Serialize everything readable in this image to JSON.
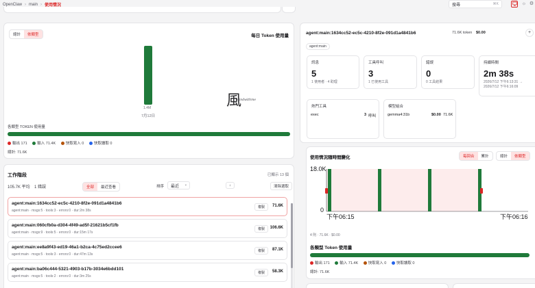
{
  "topbar": {
    "crumb1": "OpenClaw",
    "crumb2": "main",
    "crumb3": "使用情況",
    "sep": "›",
    "search_label": "搜尋",
    "search_kbd": "⌘K"
  },
  "icons": {
    "monitor": "monitor-icon",
    "sun": "sun-icon",
    "gear": "settings-icon",
    "accent": "#dc2626"
  },
  "daily": {
    "seg_total": "總計",
    "seg_bytype": "依類型",
    "title": "每日 Token 使用量",
    "bar_value_label": "1.4M",
    "bar_date": "7月12日",
    "watermark": "風",
    "watermark_sub": "windwithme",
    "type_title": "各類型 TOKEN 使用量",
    "legend": [
      {
        "label": "輸出 171",
        "color": "#dc2626"
      },
      {
        "label": "輸入 71.4K",
        "color": "#1f7a3a"
      },
      {
        "label": "快取寫入 0",
        "color": "#b45309"
      },
      {
        "label": "快取讀取 0",
        "color": "#2563eb"
      }
    ],
    "total": "總計: 71.6K"
  },
  "chart_data": [
    {
      "type": "bar",
      "title": "每日 Token 使用量",
      "categories": [
        "7月12日"
      ],
      "values": [
        1400000
      ],
      "data_labels": [
        "1.4M"
      ]
    },
    {
      "type": "bar",
      "title": "使用情況隨時間變化",
      "ylim": [
        0,
        18000
      ],
      "y_ticks": [
        "18.0K",
        "0"
      ],
      "x_ticks": [
        "下午06:15",
        "下午06:16"
      ],
      "bars": 4
    }
  ],
  "sessions": {
    "title": "工作階段",
    "selected_count": "已顯示 13 個",
    "avg": "105.7K 平均",
    "errors": "1 錯誤",
    "tab_all": "全部",
    "tab_recent": "最近查看",
    "sort_label": "排序",
    "sort_value": "最近",
    "sort_dir": "↓",
    "clear": "清除選取",
    "copy": "複製",
    "items": [
      {
        "name": "agent:main:1634cc52-ec5c-4210-8f2e-091d1a4841b6",
        "meta": "agent:main · msgs:5 · tools:3 · errors:0 · dur:2m 38s",
        "tokens": "71.6K"
      },
      {
        "name": "agent:main:060cfb0a-d304-4f49-ad5f-21621b5cf1fb",
        "meta": "agent:main · msgs:9 · tools:5 · errors:0 · dur:15m 17s",
        "tokens": "106.6K"
      },
      {
        "name": "agent:main:ee8a9f43-ed19-46a1-b2ca-4c75ed2ccee6",
        "meta": "agent:main · msgs:5 · tools:3 · errors:0 · dur:47m 13s",
        "tokens": "87.1K"
      },
      {
        "name": "agent:main:ba06c444-5321-4903-b17b-3034e6bdd101",
        "meta": "agent:main · msgs:5 · tools:2 · errors:0 · dur:3m 25s",
        "tokens": "58.3K"
      }
    ]
  },
  "detail": {
    "session_id": "agent:main:1634cc52-ec5c-4210-8f2e-091d1a4841b6",
    "tokens": "71.6K token",
    "cost": "$0.00",
    "add": "+",
    "tag": "agent:main",
    "stats": [
      {
        "label": "訊息",
        "value": "5",
        "sub": "1 使用者 · 4 助理"
      },
      {
        "label": "工具呼叫",
        "value": "3",
        "sub": "1 已使用工具"
      },
      {
        "label": "錯誤",
        "value": "0",
        "sub": "0 工具結果"
      },
      {
        "label": "持續時間",
        "value": "2m 38s",
        "sub": "2026/7/12 下午6:13:31 →",
        "sub2": "2026/7/12 下午6:16:09"
      }
    ],
    "hot_tools": {
      "title": "熱門工具",
      "name": "exec",
      "count": "3",
      "unit": "呼叫"
    },
    "model_mix": {
      "title": "模型組合",
      "name": "gemma4:31b",
      "cost": "$0.00",
      "tokens": "71.6K"
    }
  },
  "timeline": {
    "title": "使用情況隨時間變化",
    "seg_per_turn": "每回合",
    "seg_cumulative": "累計",
    "seg_total": "總計",
    "seg_bytype": "依類型",
    "y_max": "18.0K",
    "y_min": "0",
    "x_start": "下午06:15",
    "x_end": "下午06:16",
    "summary": "4 則 · 71.6K · $0.00",
    "type_title": "各類型 Token 使用量",
    "legend": [
      {
        "label": "輸出 171",
        "color": "#dc2626"
      },
      {
        "label": "輸入 71.4K",
        "color": "#1f7a3a"
      },
      {
        "label": "快取寫入 0",
        "color": "#b45309"
      },
      {
        "label": "快取讀取 0",
        "color": "#2563eb"
      }
    ],
    "total": "總計: 71.6K"
  }
}
